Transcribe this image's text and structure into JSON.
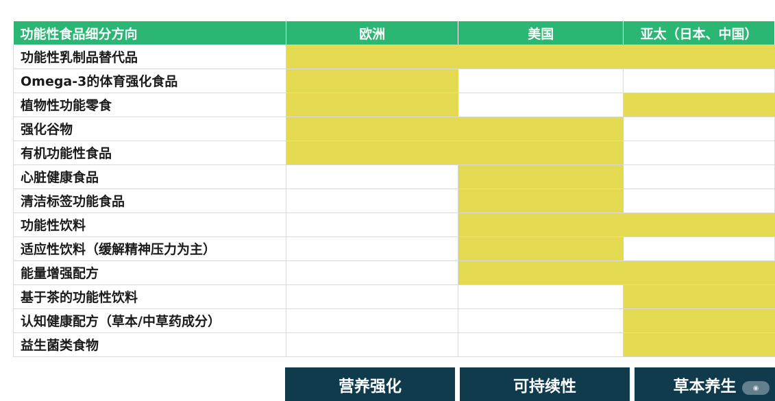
{
  "colors": {
    "header_bg": "#2bb673",
    "highlight": "#e4da52",
    "empty": "#ffffff",
    "footer_bg": "#0f3b4d"
  },
  "header": {
    "title": "",
    "column_category": "功能性食品细分方向",
    "regions": [
      "欧洲",
      "美国",
      "亚太（日本、中国）"
    ]
  },
  "rows": [
    {
      "label": "功能性乳制品替代品",
      "cells": [
        true,
        true,
        true
      ]
    },
    {
      "label": "Omega-3的体育强化食品",
      "cells": [
        true,
        false,
        false
      ]
    },
    {
      "label": "植物性功能零食",
      "cells": [
        true,
        false,
        true
      ]
    },
    {
      "label": "强化谷物",
      "cells": [
        true,
        true,
        false
      ]
    },
    {
      "label": "有机功能性食品",
      "cells": [
        true,
        true,
        false
      ]
    },
    {
      "label": "心脏健康食品",
      "cells": [
        false,
        true,
        false
      ]
    },
    {
      "label": "清洁标签功能食品",
      "cells": [
        false,
        true,
        false
      ]
    },
    {
      "label": "功能性饮料",
      "cells": [
        false,
        true,
        true
      ]
    },
    {
      "label": "适应性饮料（缓解精神压力为主）",
      "cells": [
        false,
        true,
        false
      ]
    },
    {
      "label": "能量增强配方",
      "cells": [
        false,
        true,
        true
      ]
    },
    {
      "label": "基于茶的功能性饮料",
      "cells": [
        false,
        false,
        true
      ]
    },
    {
      "label": "认知健康配方（草本/中草药成分）",
      "cells": [
        false,
        false,
        true
      ]
    },
    {
      "label": "益生菌类食物",
      "cells": [
        false,
        false,
        true
      ]
    }
  ],
  "footer": {
    "labels": [
      "营养强化",
      "可持续性",
      "草本养生"
    ]
  },
  "watermark_icon": "xiaohongshu-watermark-icon"
}
